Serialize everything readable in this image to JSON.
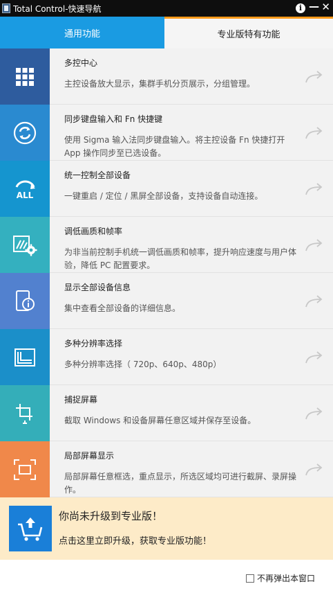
{
  "window": {
    "title": "Total Control-快速导航"
  },
  "tabs": [
    {
      "label": "通用功能"
    },
    {
      "label": "专业版特有功能"
    }
  ],
  "colors": {
    "tab_active": "#1a9be2",
    "tab_accent": "#ff9a1a",
    "promo_bg": "#fdebc8",
    "promo_icon": "#1a7fd8"
  },
  "features": [
    {
      "title": "多控中心",
      "desc": "主控设备放大显示，集群手机分页展示，分组管理。",
      "icon": "grid-icon",
      "color": "#2e5c9e"
    },
    {
      "title": "同步键盘输入和 Fn 快捷键",
      "desc": "使用 Sigma 输入法同步键盘输入。将主控设备 Fn 快捷打开 App 操作同步至已选设备。",
      "icon": "sync-icon",
      "color": "#2a8ad0"
    },
    {
      "title": "统一控制全部设备",
      "desc": "一键重启 / 定位 / 黑屏全部设备，支持设备自动连接。",
      "icon": "all-devices-icon",
      "color": "#1595cf"
    },
    {
      "title": "调低画质和帧率",
      "desc": "为非当前控制手机统一调低画质和帧率，提升响应速度与用户体验，降低 PC 配置要求。",
      "icon": "quality-settings-icon",
      "color": "#34b0bf"
    },
    {
      "title": "显示全部设备信息",
      "desc": "集中查看全部设备的详细信息。",
      "icon": "device-info-icon",
      "color": "#5281cf"
    },
    {
      "title": "多种分辨率选择",
      "desc": "多种分辨率选择（ 720p、640p、480p）",
      "icon": "resolution-icon",
      "color": "#1b8fc9"
    },
    {
      "title": "捕捉屏幕",
      "desc": "截取 Windows 和设备屏幕任意区域并保存至设备。",
      "icon": "capture-screen-icon",
      "color": "#34aeb9"
    },
    {
      "title": "局部屏幕显示",
      "desc": "局部屏幕任意框选，重点显示，所选区域均可进行截屏、录屏操作。",
      "icon": "partial-screen-icon",
      "color": "#f0884a"
    }
  ],
  "promo": {
    "title": "你尚未升级到专业版！",
    "link": "点击这里立即升级，获取专业版功能！"
  },
  "footer": {
    "checkbox_label": "不再弹出本窗口",
    "checked": false
  }
}
